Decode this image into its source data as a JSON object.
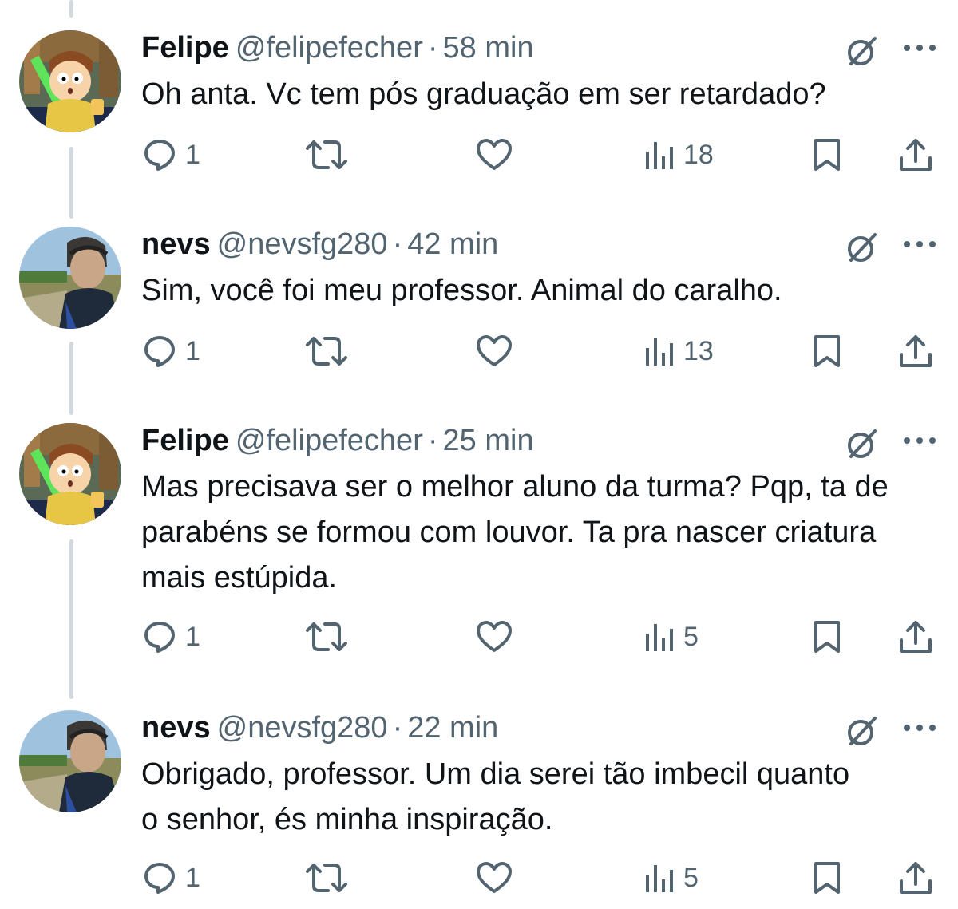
{
  "tweets": [
    {
      "author": "Felipe",
      "handle": "@felipefecher",
      "separator": "·",
      "time": "58 min",
      "avatar": "cartoon-avatar",
      "text": "Oh anta. Vc tem pós graduação em ser retardado?",
      "replies": "1",
      "retweets": "",
      "likes": "",
      "views": "18"
    },
    {
      "author": "nevs",
      "handle": "@nevsfg280",
      "separator": "·",
      "time": "42 min",
      "avatar": "photo-avatar",
      "text": "Sim, você foi meu professor. Animal do caralho.",
      "replies": "1",
      "retweets": "",
      "likes": "",
      "views": "13"
    },
    {
      "author": "Felipe",
      "handle": "@felipefecher",
      "separator": "·",
      "time": "25 min",
      "avatar": "cartoon-avatar",
      "text": "Mas precisava ser o melhor aluno da turma? Pqp, ta de parabéns se formou com louvor. Ta pra nascer criatura mais estúpida.",
      "replies": "1",
      "retweets": "",
      "likes": "",
      "views": "5"
    },
    {
      "author": "nevs",
      "handle": "@nevsfg280",
      "separator": "·",
      "time": "22 min",
      "avatar": "photo-avatar",
      "text": "Obrigado, professor. Um dia serei tão imbecil quanto o senhor, és minha inspiração.",
      "replies": "1",
      "retweets": "",
      "likes": "",
      "views": "5"
    }
  ],
  "colors": {
    "text": "#0f1419",
    "secondary": "#536471",
    "thread_line": "#cfd9de",
    "background": "#ffffff"
  }
}
